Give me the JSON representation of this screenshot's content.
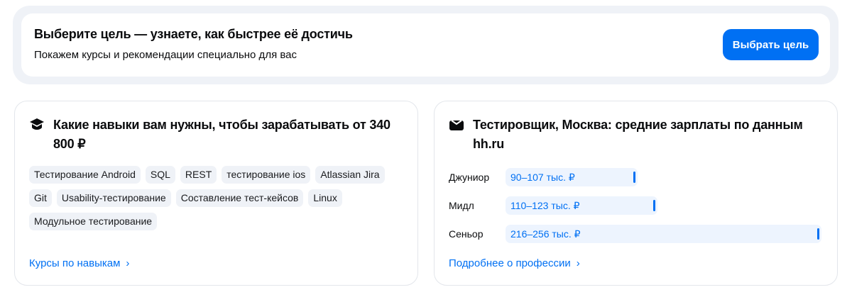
{
  "banner": {
    "title": "Выберите цель — узнаете, как быстрее её достичь",
    "subtitle": "Покажем курсы и рекомендации специально для вас",
    "button": "Выбрать цель"
  },
  "skills": {
    "icon": "graduation-cap-icon",
    "title": "Какие навыки вам нужны, чтобы зарабатывать от 340 800 ₽",
    "tags": [
      "Тестирование Android",
      "SQL",
      "REST",
      "тестирование ios",
      "Atlassian Jira",
      "Git",
      "Usability-тестирование",
      "Составление тест-кейсов",
      "Linux",
      "Модульное тестирование"
    ],
    "link": "Курсы по навыкам"
  },
  "salary": {
    "icon": "briefcase-icon",
    "title": "Тестировщик, Москва: средние зарплаты по данным hh.ru",
    "rows": [
      {
        "label": "Джуниор",
        "range": "90–107 тыс. ₽",
        "max": 107
      },
      {
        "label": "Мидл",
        "range": "110–123 тыс. ₽",
        "max": 123
      },
      {
        "label": "Сеньор",
        "range": "216–256 тыс. ₽",
        "max": 256
      }
    ],
    "link": "Подробнее о профессии"
  },
  "colors": {
    "accent": "#0070f3",
    "bar": "#edf4fe"
  }
}
